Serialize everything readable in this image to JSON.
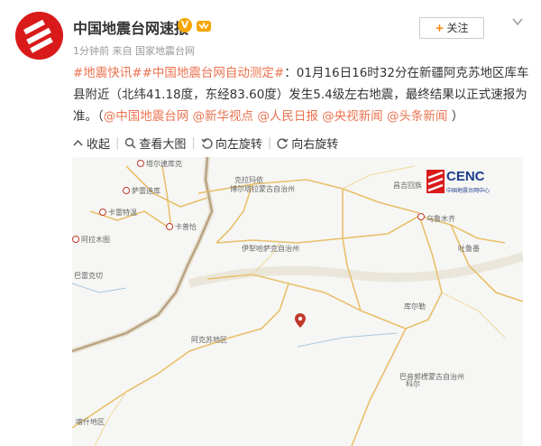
{
  "account": {
    "name": "中国地震台网速报",
    "badge": "V",
    "meta_time": "1分钟前",
    "meta_from": "来自",
    "meta_source": "国家地震台网"
  },
  "actions": {
    "follow_label": "关注"
  },
  "post": {
    "topic1": "#地震快讯#",
    "topic2": "#中国地震台网自动测定#",
    "body": "：01月16日16时32分在新疆阿克苏地区库车县附近（北纬41.18度，东经83.60度）发生5.4级左右地震，最终结果以正式速报为准。（",
    "mentions": [
      "@中国地震台网",
      "@新华视点",
      "@人民日报",
      "@央视新闻",
      "@头条新闻"
    ],
    "close": "）"
  },
  "toolbar": {
    "collapse": "收起",
    "view_large": "查看大图",
    "rotate_left": "向左旋转",
    "rotate_right": "向右旋转"
  },
  "map": {
    "logo_text": "CENC",
    "logo_sub": "中国地震台网中心",
    "labels": {
      "l1": "塔尔逮库克",
      "l2": "萨雷迪库",
      "l3": "卡雷特温",
      "l4": "阿拉木图",
      "l5": "巴雷克切",
      "l6": "卡普恰",
      "l7": "克拉玛依",
      "l8": "博尔塔拉蒙古自治州",
      "l9": "伊犁哈萨克自治州",
      "l10": "乌鲁木齐",
      "l11": "吐鲁番",
      "l12": "昌吉回族",
      "l13": "阿克苏地区",
      "l14": "巴音郭楞蒙古自治州",
      "l15": "库尔勒",
      "l16": "喀什地区",
      "l17": "科尔"
    },
    "colors": {
      "road": "#e8c06a",
      "border": "#a08a6a",
      "land": "#f6f6f4",
      "marker": "#c0392b"
    }
  }
}
